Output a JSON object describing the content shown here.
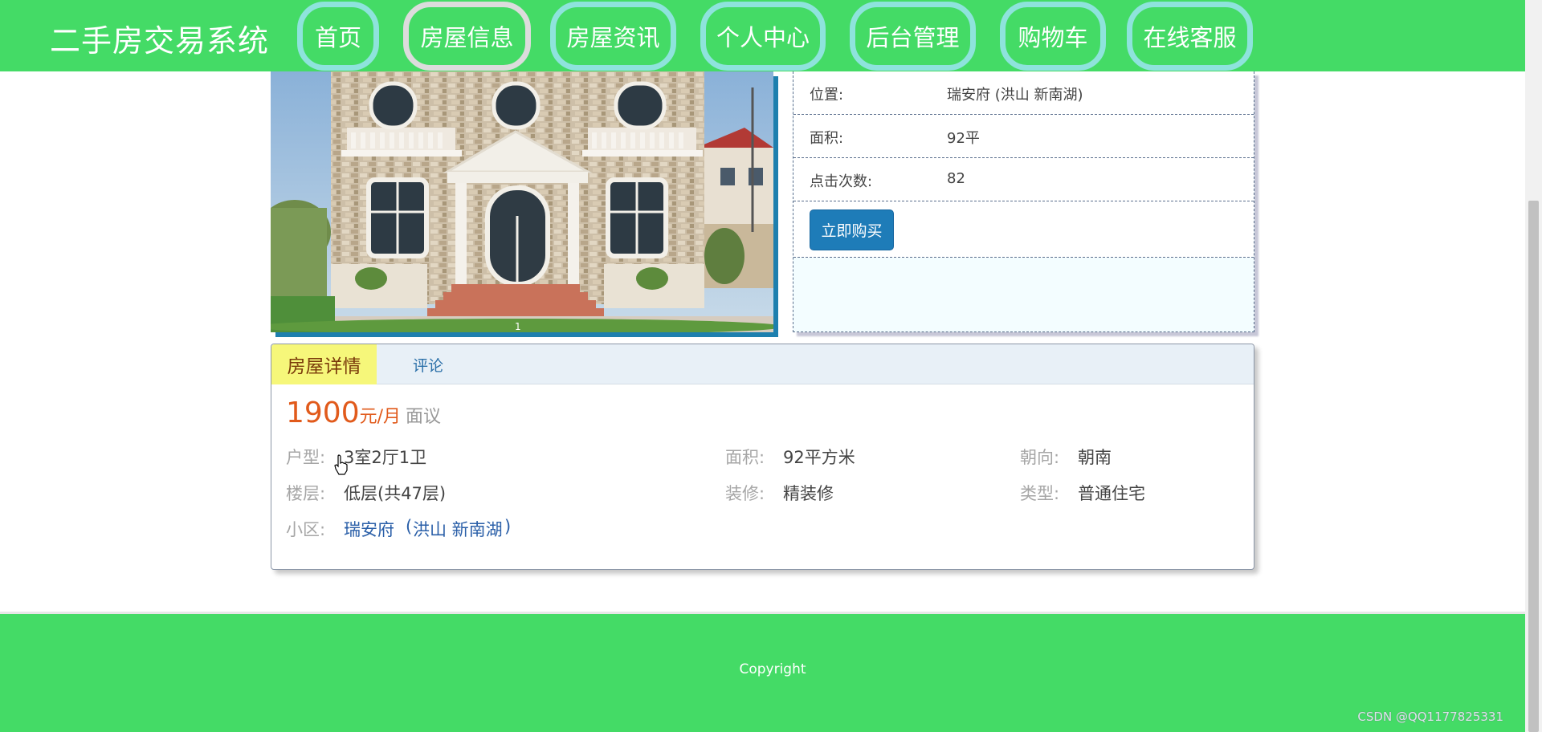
{
  "header": {
    "brand": "二手房交易系统",
    "nav": [
      {
        "label": "首页",
        "active": false
      },
      {
        "label": "房屋信息",
        "active": true
      },
      {
        "label": "房屋资讯",
        "active": false
      },
      {
        "label": "个人中心",
        "active": false
      },
      {
        "label": "后台管理",
        "active": false
      },
      {
        "label": "购物车",
        "active": false
      },
      {
        "label": "在线客服",
        "active": false
      }
    ],
    "accent": "#44db66"
  },
  "photo": {
    "indicator": "1"
  },
  "info": {
    "location_label": "位置:",
    "location_value": "瑞安府 (洪山 新南湖)",
    "area_label": "面积:",
    "area_value": "92平",
    "clicks_label": "点击次数:",
    "clicks_value": "82",
    "buy_button": "立即购买",
    "buy_color": "#1e7cb8"
  },
  "detail": {
    "tabs": [
      "房屋详情",
      "评论"
    ],
    "price": "1900",
    "price_unit": "元/月",
    "negotiable": "面议",
    "fields": {
      "layout_label": "户型:",
      "layout_value": "3室2厅1卫",
      "area_label": "面积:",
      "area_value": "92平方米",
      "orientation_label": "朝向:",
      "orientation_value": "朝南",
      "floor_label": "楼层:",
      "floor_value": "低层(共47层)",
      "decoration_label": "装修:",
      "decoration_value": "精装修",
      "type_label": "类型:",
      "type_value": "普通住宅",
      "community_label": "小区:",
      "community_name": "瑞安府",
      "community_open": "(",
      "community_district": "洪山 新南湖",
      "community_close": ")"
    }
  },
  "footer": {
    "copyright": "Copyright",
    "watermark": "CSDN @QQ1177825331"
  }
}
